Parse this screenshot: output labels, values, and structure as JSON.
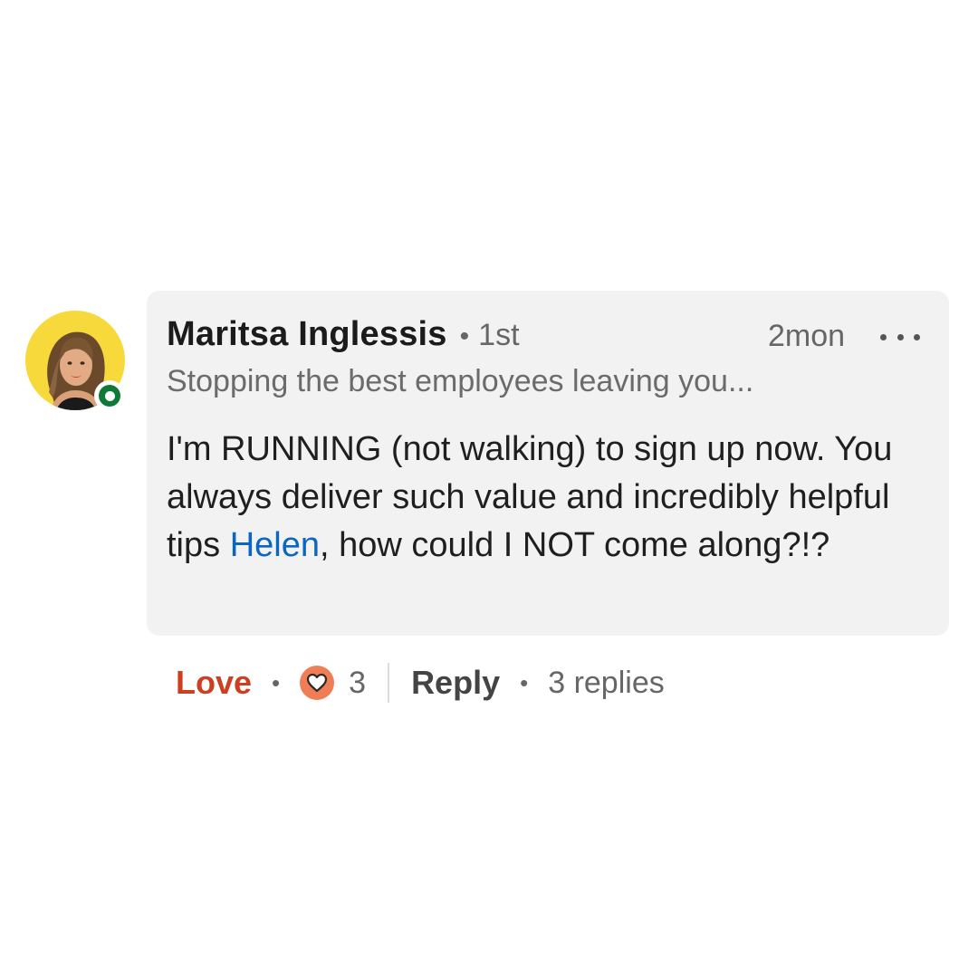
{
  "comment": {
    "author_name": "Maritsa Inglessis",
    "connection_degree": "1st",
    "timestamp": "2mon",
    "headline": "Stopping the best employees leaving you...",
    "body_before_mention": "I'm RUNNING (not walking) to sign up now. You always deliver such value and incredibly helpful tips ",
    "mention": "Helen",
    "body_after_mention": ", how could I NOT come along?!?",
    "more_icon": "more-horizontal-icon",
    "status": "online"
  },
  "actions": {
    "love_label": "Love",
    "reaction_icon": "heart-icon",
    "reaction_count": "3",
    "reply_label": "Reply",
    "replies_label": "3 replies"
  },
  "colors": {
    "bubble": "#f2f2f2",
    "love": "#cc3f21",
    "mention": "#0a66c2",
    "avatar_bg": "#f8d93b",
    "status": "#0d7a3a",
    "heart_badge": "#ef7d56"
  }
}
